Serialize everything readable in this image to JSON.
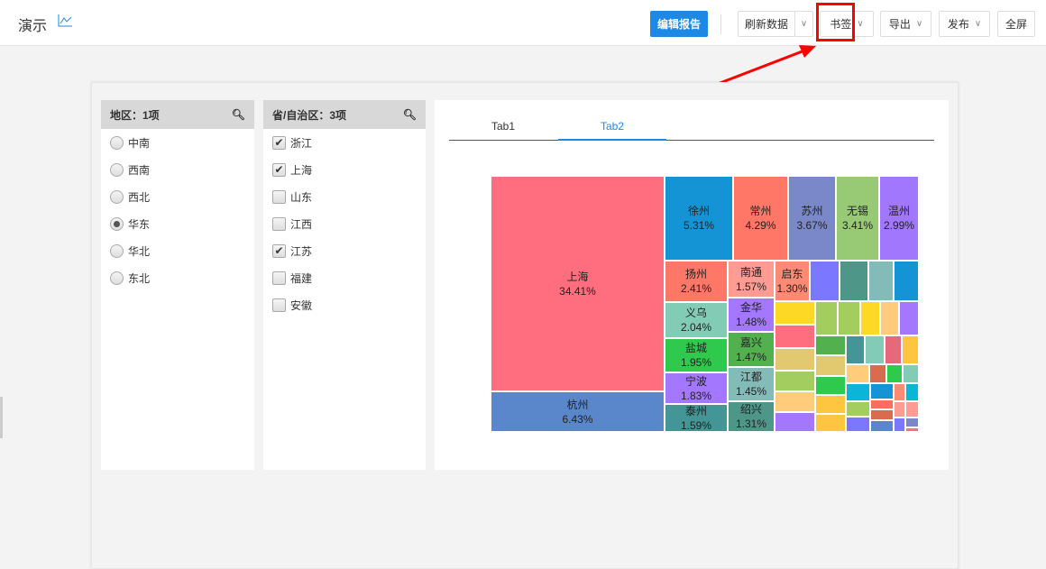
{
  "header": {
    "title": "演示",
    "edit_report": "编辑报告",
    "refresh": "刷新数据",
    "bookmark": "书签",
    "export": "导出",
    "publish": "发布",
    "fullscreen": "全屏"
  },
  "filters": {
    "region": {
      "title": "地区：1项",
      "options": [
        {
          "label": "中南",
          "selected": false
        },
        {
          "label": "西南",
          "selected": false
        },
        {
          "label": "西北",
          "selected": false
        },
        {
          "label": "华东",
          "selected": true
        },
        {
          "label": "华北",
          "selected": false
        },
        {
          "label": "东北",
          "selected": false
        }
      ]
    },
    "province": {
      "title": "省/自治区：3项",
      "options": [
        {
          "label": "浙江",
          "checked": true
        },
        {
          "label": "上海",
          "checked": true
        },
        {
          "label": "山东",
          "checked": false
        },
        {
          "label": "江西",
          "checked": false
        },
        {
          "label": "江苏",
          "checked": true
        },
        {
          "label": "福建",
          "checked": false
        },
        {
          "label": "安徽",
          "checked": false
        }
      ]
    }
  },
  "tabs": [
    "Tab1",
    "Tab2"
  ],
  "active_tab": "Tab2",
  "chart_data": {
    "type": "treemap",
    "items": [
      {
        "name": "上海",
        "value": "34.41%",
        "color": "#fe6e7e"
      },
      {
        "name": "杭州",
        "value": "6.43%",
        "color": "#5a87cc"
      },
      {
        "name": "徐州",
        "value": "5.31%",
        "color": "#1494d4"
      },
      {
        "name": "常州",
        "value": "4.29%",
        "color": "#fe7767"
      },
      {
        "name": "苏州",
        "value": "3.67%",
        "color": "#7a87c9"
      },
      {
        "name": "无锡",
        "value": "3.41%",
        "color": "#98c974"
      },
      {
        "name": "温州",
        "value": "2.99%",
        "color": "#a177fd"
      },
      {
        "name": "扬州",
        "value": "2.41%",
        "color": "#fe7767"
      },
      {
        "name": "义乌",
        "value": "2.04%",
        "color": "#82cbb4"
      },
      {
        "name": "盐城",
        "value": "1.95%",
        "color": "#2fc94e"
      },
      {
        "name": "宁波",
        "value": "1.83%",
        "color": "#a377fe"
      },
      {
        "name": "泰州",
        "value": "1.59%",
        "color": "#449595"
      },
      {
        "name": "南通",
        "value": "1.57%",
        "color": "#fe9c94"
      },
      {
        "name": "金华",
        "value": "1.48%",
        "color": "#a377fe"
      },
      {
        "name": "嘉兴",
        "value": "1.47%",
        "color": "#52b04e"
      },
      {
        "name": "江都",
        "value": "1.45%",
        "color": "#82bbb8"
      },
      {
        "name": "绍兴",
        "value": "1.31%",
        "color": "#4e9688"
      },
      {
        "name": "启东",
        "value": "1.30%",
        "color": "#fe8a74"
      }
    ],
    "unlabeled_colors": [
      "#7b78ff",
      "#4e9688",
      "#82bbb8",
      "#1494d4",
      "#fdd825",
      "#fe6e7e",
      "#e2c86e",
      "#a3cd5e",
      "#fecc7a",
      "#a377fe",
      "#a3cd5e",
      "#a3cd5e",
      "#fdd825",
      "#fecc7a",
      "#a377fe",
      "#52b04e",
      "#e2c86e",
      "#2fc94e",
      "#fdc540",
      "#fdc540",
      "#449595",
      "#82cbb4",
      "#e5697b",
      "#fdc540",
      "#fecc7a",
      "#d96b4f",
      "#2fc94e",
      "#82cbb4",
      "#0bb5d8",
      "#1494d4",
      "#fe8a74",
      "#0bb5d8",
      "#a3cd5e",
      "#fe6e5e",
      "#fe9c94",
      "#fe9c94",
      "#7b78ff",
      "#d96b4f",
      "#7a87c9",
      "#5a87cc",
      "#7b78ff",
      "#fe6e7e"
    ]
  }
}
